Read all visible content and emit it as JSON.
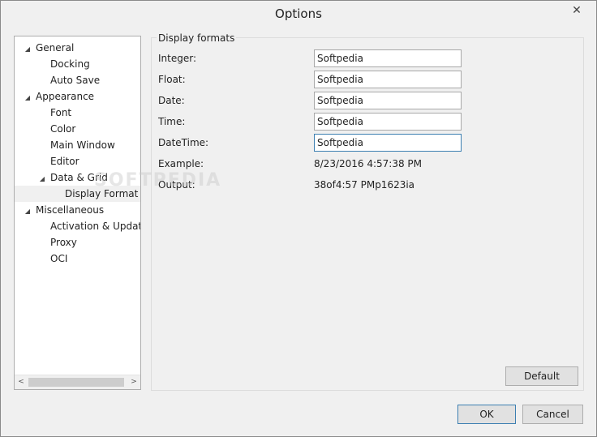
{
  "window": {
    "title": "Options",
    "close_glyph": "✕"
  },
  "tree": {
    "items": [
      {
        "label": "General",
        "level": 0,
        "expander": "◢",
        "selected": false
      },
      {
        "label": "Docking",
        "level": 1,
        "expander": "",
        "selected": false
      },
      {
        "label": "Auto Save",
        "level": 1,
        "expander": "",
        "selected": false
      },
      {
        "label": "Appearance",
        "level": 0,
        "expander": "◢",
        "selected": false
      },
      {
        "label": "Font",
        "level": 1,
        "expander": "",
        "selected": false
      },
      {
        "label": "Color",
        "level": 1,
        "expander": "",
        "selected": false
      },
      {
        "label": "Main Window",
        "level": 1,
        "expander": "",
        "selected": false
      },
      {
        "label": "Editor",
        "level": 1,
        "expander": "",
        "selected": false
      },
      {
        "label": "Data & Grid",
        "level": 1,
        "expander": "◢",
        "selected": false
      },
      {
        "label": "Display Format",
        "level": 2,
        "expander": "",
        "selected": true
      },
      {
        "label": "Miscellaneous",
        "level": 0,
        "expander": "◢",
        "selected": false
      },
      {
        "label": "Activation & Updates",
        "level": 1,
        "expander": "",
        "selected": false
      },
      {
        "label": "Proxy",
        "level": 1,
        "expander": "",
        "selected": false
      },
      {
        "label": "OCI",
        "level": 1,
        "expander": "",
        "selected": false
      }
    ],
    "scroll_left_glyph": "<",
    "scroll_right_glyph": ">"
  },
  "display_formats": {
    "group_title": "Display formats",
    "integer": {
      "label": "Integer:",
      "value": "Softpedia"
    },
    "float": {
      "label": "Float:",
      "value": "Softpedia"
    },
    "date": {
      "label": "Date:",
      "value": "Softpedia"
    },
    "time": {
      "label": "Time:",
      "value": "Softpedia"
    },
    "datetime": {
      "label": "DateTime:",
      "value": "Softpedia"
    },
    "example": {
      "label": "Example:",
      "value": "8/23/2016 4:57:38 PM"
    },
    "output": {
      "label": "Output:",
      "value": "38of4:57 PMp1623ia"
    },
    "default_button": "Default"
  },
  "footer": {
    "ok_button": "OK",
    "cancel_button": "Cancel"
  },
  "watermark": "SOFTPEDIA"
}
